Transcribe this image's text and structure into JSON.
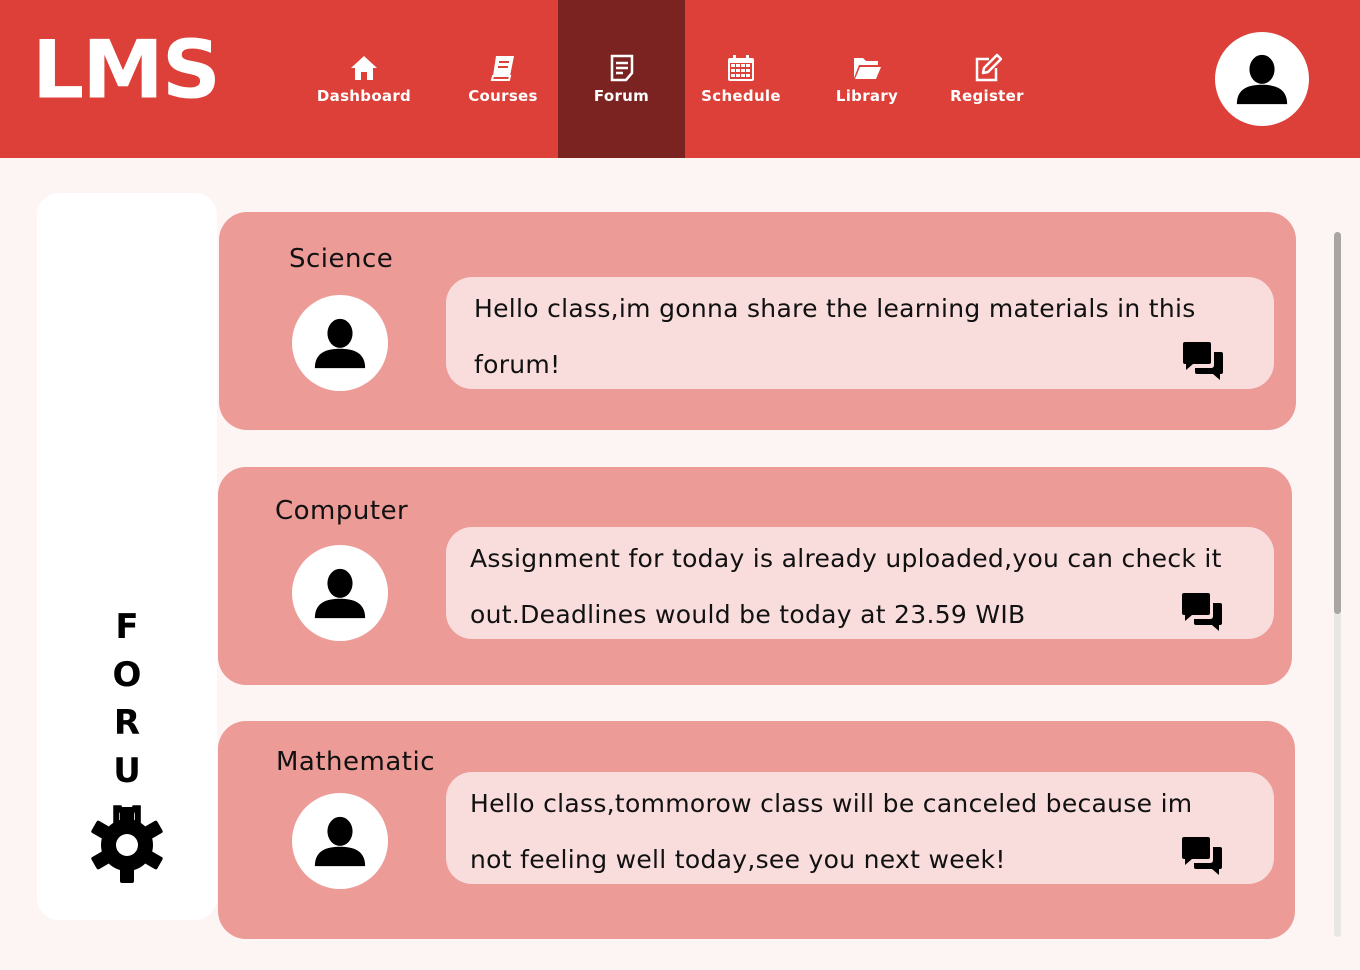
{
  "app": {
    "logo": "LMS"
  },
  "nav": [
    {
      "label": "Dashboard",
      "icon": "home-icon"
    },
    {
      "label": "Courses",
      "icon": "book-icon"
    },
    {
      "label": "Forum",
      "icon": "forum-note-icon",
      "active": true
    },
    {
      "label": "Schedule",
      "icon": "calendar-icon"
    },
    {
      "label": "Library",
      "icon": "folder-open-icon"
    },
    {
      "label": "Register",
      "icon": "edit-icon"
    }
  ],
  "sidebar": {
    "title_letters": [
      "F",
      "O",
      "R",
      "U",
      "M"
    ],
    "settings_icon": "gear-icon"
  },
  "posts": [
    {
      "subject": "Science",
      "message": "Hello class,im gonna share the learning materials in this forum!",
      "reply_icon": "chat-bubbles-icon"
    },
    {
      "subject": "Computer",
      "message": "Assignment for today is already uploaded,you can check it out.Deadlines would be today at 23.59 WIB",
      "reply_icon": "chat-bubbles-icon"
    },
    {
      "subject": "Mathematic",
      "message": "Hello class,tommorow class will be canceled because im not feeling well today,see you next week!",
      "reply_icon": "chat-bubbles-icon"
    }
  ],
  "colors": {
    "header": "#dc4039",
    "nav_active": "#7a2320",
    "card": "#ec9b97",
    "bubble": "#f9dcdc",
    "background": "#fdf5f4"
  }
}
